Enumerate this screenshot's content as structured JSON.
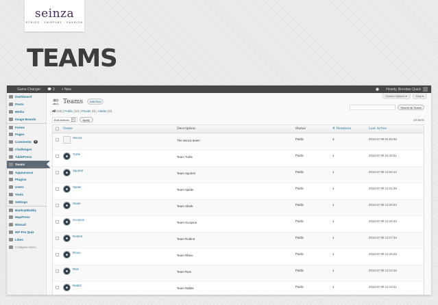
{
  "logo": {
    "word": "seinza",
    "tagline": "ETHICS · FAIRPLAY · PASSION"
  },
  "slide_title": "TEAMS",
  "adminbar": {
    "site_name": "Game Changer",
    "comments_count": "3",
    "new_label": "+ New",
    "greeting": "Howdy, Brendan Quick"
  },
  "sidebar": {
    "items": [
      {
        "label": "Dashboard",
        "icon": "dashboard-icon"
      },
      {
        "label": "Posts",
        "icon": "pin-icon"
      },
      {
        "label": "Media",
        "icon": "media-icon"
      },
      {
        "label": "Image Boards",
        "icon": "image-icon"
      },
      {
        "label": "Forms",
        "icon": "form-icon"
      },
      {
        "label": "Pages",
        "icon": "page-icon"
      },
      {
        "label": "Comments",
        "icon": "comment-icon",
        "badge": "3"
      },
      {
        "label": "Challenges",
        "icon": "pin-icon"
      },
      {
        "label": "TablePress",
        "icon": "table-icon"
      },
      {
        "label": "Teams",
        "icon": "pin-icon",
        "active": true
      },
      {
        "label": "Appearance",
        "icon": "appearance-icon"
      },
      {
        "label": "Plugins",
        "icon": "plugin-icon"
      },
      {
        "label": "Users",
        "icon": "users-icon"
      },
      {
        "label": "Tools",
        "icon": "tools-icon"
      },
      {
        "label": "Settings",
        "icon": "settings-icon"
      },
      {
        "label": "BackupBuddy",
        "icon": "backup-icon"
      },
      {
        "label": "MapPress",
        "icon": "map-icon"
      },
      {
        "label": "Manual",
        "icon": "manual-icon"
      },
      {
        "label": "WP Pro Quiz",
        "icon": "quiz-icon"
      },
      {
        "label": "Likes",
        "icon": "likes-icon"
      },
      {
        "label": "Collapse menu",
        "icon": "collapse-icon"
      }
    ]
  },
  "screen_options": "Screen Options ▾",
  "help": "Help ▾",
  "page": {
    "title": "Teams",
    "add_new": "Add New",
    "views": {
      "all": "All",
      "all_count": "(10)",
      "public": "Public",
      "public_count": "(10)",
      "private": "Private",
      "private_count": "(0)",
      "hidden": "Hidden",
      "hidden_count": "(0)"
    },
    "search_placeholder": "",
    "search_button": "Search all Teams",
    "bulk_actions": "Bulk Actions",
    "apply": "Apply",
    "items_count": "10 items"
  },
  "table": {
    "columns": [
      "Name",
      "Description",
      "Status",
      "# Members",
      "Last Active"
    ],
    "rows": [
      {
        "name": "Seinza",
        "description": "The seinza team!",
        "status": "Public",
        "members": "3",
        "last_active": "2013-07-09 01:53:35",
        "logo": true
      },
      {
        "name": "Turtle",
        "description": "Team Turtle",
        "status": "Public",
        "members": "1",
        "last_active": "2013-07-05 15:42:51"
      },
      {
        "name": "Squirrel",
        "description": "Team Squirrel",
        "status": "Public",
        "members": "1",
        "last_active": "2013-07-05 13:20:12"
      },
      {
        "name": "Spider",
        "description": "Team Spider",
        "status": "Public",
        "members": "1",
        "last_active": "2013-07-05 13:21:49"
      },
      {
        "name": "Shark",
        "description": "Team Shark",
        "status": "Public",
        "members": "1",
        "last_active": "2013-07-05 13:20:23"
      },
      {
        "name": "Scorpion",
        "description": "Team Scorpion",
        "status": "Public",
        "members": "1",
        "last_active": "2013-07-05 13:16:43"
      },
      {
        "name": "Rodent",
        "description": "Team Rodent",
        "status": "Public",
        "members": "1",
        "last_active": "2013-07-05 13:17:34"
      },
      {
        "name": "Rhino",
        "description": "Team Rhino",
        "status": "Public",
        "members": "1",
        "last_active": "2013-07-05 13:15:28"
      },
      {
        "name": "Ram",
        "description": "Team Ram",
        "status": "Public",
        "members": "1",
        "last_active": "2013-07-05 13:10:16"
      },
      {
        "name": "Rabbit",
        "description": "Team Rabbit",
        "status": "Public",
        "members": "1",
        "last_active": "2013-07-05 13:14:21"
      }
    ]
  }
}
